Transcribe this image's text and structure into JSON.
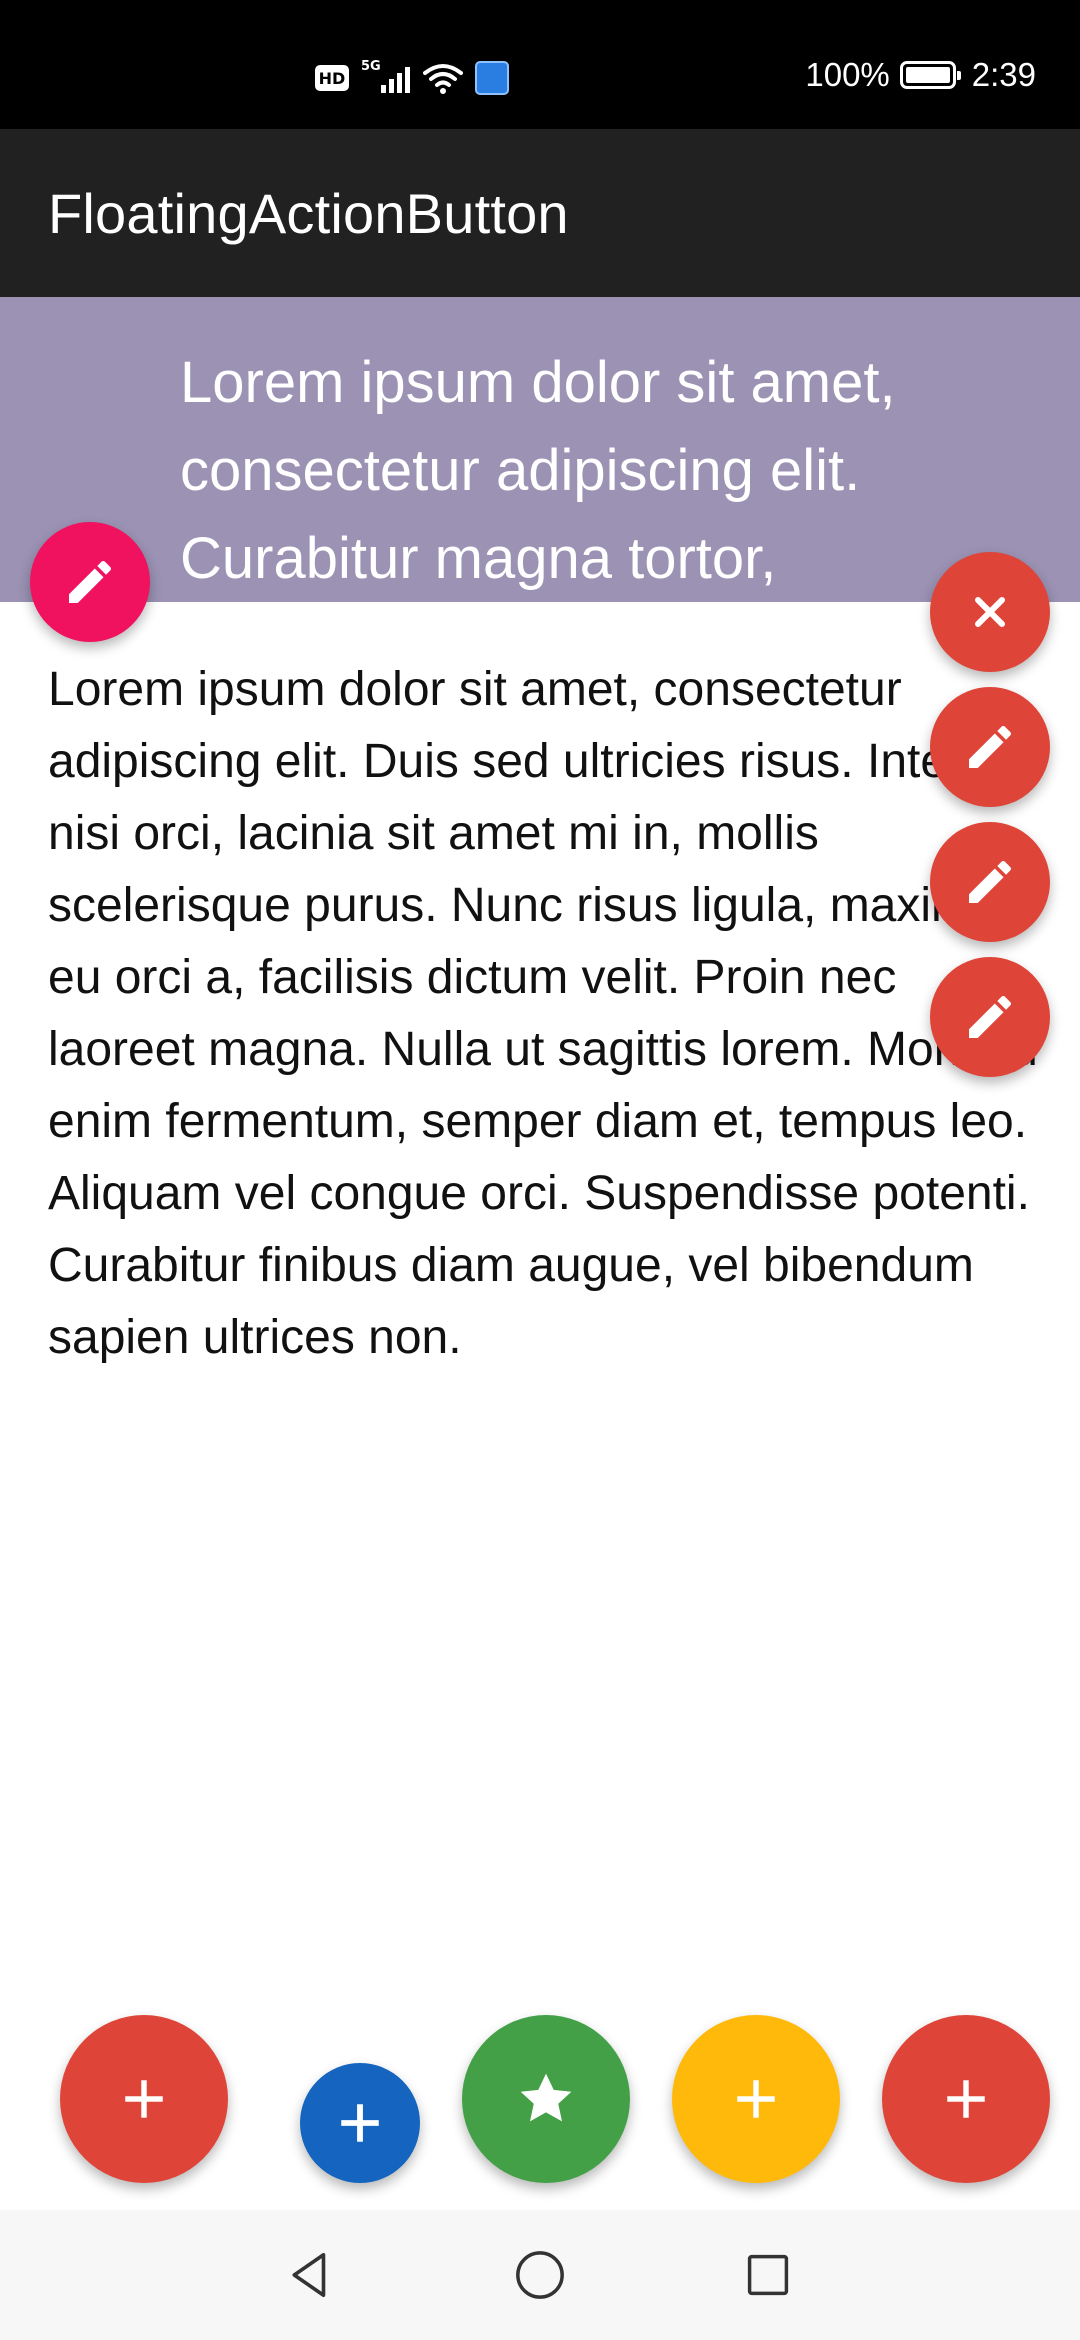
{
  "status_bar": {
    "hd_label": "HD",
    "network_label": "5G",
    "battery_percent": "100%",
    "time": "2:39"
  },
  "app_bar": {
    "title": "FloatingActionButton"
  },
  "header": {
    "text": "Lorem ipsum dolor sit amet, consectetur adipiscing elit. Curabitur magna tortor,",
    "background_color": "#9b92b4"
  },
  "body": {
    "text": "Lorem ipsum dolor sit amet, consectetur adipiscing elit. Duis sed ultricies risus. Integer nisi orci, lacinia sit amet mi in, mollis scelerisque purus. Nunc risus ligula, maximus eu orci a, facilisis dictum velit. Proin nec laoreet magna. Nulla ut sagittis lorem. Morbi id enim fermentum, semper diam et, tempus leo. Aliquam vel congue orci. Suspendisse potenti. Curabitur finibus diam augue, vel bibendum sapien ultrices non."
  },
  "fabs": {
    "header_fab": {
      "icon": "pencil-icon",
      "color": "#f0115f"
    },
    "menu": [
      {
        "icon": "close-icon",
        "color": "#de4437"
      },
      {
        "icon": "pencil-icon",
        "color": "#de4437"
      },
      {
        "icon": "pencil-icon",
        "color": "#de4437"
      },
      {
        "icon": "pencil-icon",
        "color": "#de4437"
      }
    ],
    "bottom": [
      {
        "icon": "plus-icon",
        "color": "#de4437"
      },
      {
        "icon": "plus-icon",
        "color": "#1565c0"
      },
      {
        "icon": "star-icon",
        "color": "#43a047"
      },
      {
        "icon": "plus-icon",
        "color": "#ffb90b"
      },
      {
        "icon": "plus-icon",
        "color": "#de4437"
      }
    ]
  },
  "nav_bar": {
    "buttons": [
      "back-icon",
      "home-icon",
      "recents-icon"
    ]
  }
}
